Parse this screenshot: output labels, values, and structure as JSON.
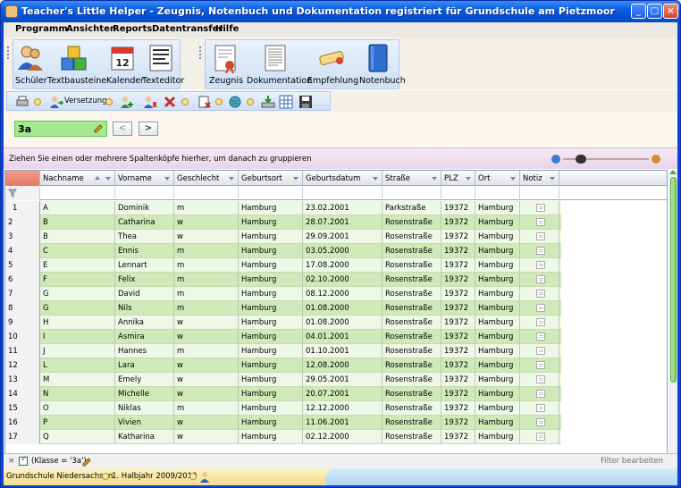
{
  "window": {
    "title": "Teacher's Little Helper - Zeugnis, Notenbuch und Dokumentation registriert für Grundschule am Pietzmoor"
  },
  "menu": [
    "Programm",
    "Ansichten",
    "Reports",
    "Datentransfer",
    "Hilfe"
  ],
  "ribbon": {
    "group1": [
      {
        "label": "Schüler",
        "icon": "students-icon"
      },
      {
        "label": "Textbausteine",
        "icon": "blocks-icon"
      },
      {
        "label": "Kalender",
        "icon": "calendar-icon"
      },
      {
        "label": "Texteditor",
        "icon": "text-editor-icon"
      }
    ],
    "group2": [
      {
        "label": "Zeugnis",
        "icon": "certificate-icon"
      },
      {
        "label": "Dokumentation",
        "icon": "documentation-icon"
      },
      {
        "label": "Empfehlung",
        "icon": "scroll-icon"
      },
      {
        "label": "Notenbuch",
        "icon": "gradebook-icon"
      }
    ],
    "calendar_day": "12"
  },
  "toolbar": {
    "versetzung_label": "Versetzung"
  },
  "class_selector": {
    "value": "3a",
    "prev": "<",
    "next": ">"
  },
  "groupbar": {
    "text": "Ziehen Sie einen oder mehrere Spaltenköpfe hierher, um danach zu gruppieren"
  },
  "table": {
    "columns": [
      "Nachname",
      "Vorname",
      "Geschlecht",
      "Geburtsort",
      "Geburtsdatum",
      "Straße",
      "PLZ",
      "Ort",
      "Notiz"
    ],
    "rows": [
      [
        "1",
        "A",
        "Dominik",
        "m",
        "Hamburg",
        "23.02.2001",
        "Parkstraße",
        "19372",
        "Hamburg"
      ],
      [
        "2",
        "B",
        "Catharina",
        "w",
        "Hamburg",
        "28.07.2001",
        "Rosenstraße",
        "19372",
        "Hamburg"
      ],
      [
        "3",
        "B",
        "Thea",
        "w",
        "Hamburg",
        "29.09.2001",
        "Rosenstraße",
        "19372",
        "Hamburg"
      ],
      [
        "4",
        "C",
        "Ennis",
        "m",
        "Hamburg",
        "03.05.2000",
        "Rosenstraße",
        "19372",
        "Hamburg"
      ],
      [
        "5",
        "E",
        "Lennart",
        "m",
        "Hamburg",
        "17.08.2000",
        "Rosenstraße",
        "19372",
        "Hamburg"
      ],
      [
        "6",
        "F",
        "Felix",
        "m",
        "Hamburg",
        "02.10.2000",
        "Rosenstraße",
        "19372",
        "Hamburg"
      ],
      [
        "7",
        "G",
        "David",
        "m",
        "Hamburg",
        "08.12.2000",
        "Rosenstraße",
        "19372",
        "Hamburg"
      ],
      [
        "8",
        "G",
        "Nils",
        "m",
        "Hamburg",
        "01.08.2000",
        "Rosenstraße",
        "19372",
        "Hamburg"
      ],
      [
        "9",
        "H",
        "Annika",
        "w",
        "Hamburg",
        "01.08.2000",
        "Rosenstraße",
        "19372",
        "Hamburg"
      ],
      [
        "10",
        "I",
        "Asmira",
        "w",
        "Hamburg",
        "04.01.2001",
        "Rosenstraße",
        "19372",
        "Hamburg"
      ],
      [
        "11",
        "J",
        "Hannes",
        "m",
        "Hamburg",
        "01.10.2001",
        "Rosenstraße",
        "19372",
        "Hamburg"
      ],
      [
        "12",
        "L",
        "Lara",
        "w",
        "Hamburg",
        "12.08.2000",
        "Rosenstraße",
        "19372",
        "Hamburg"
      ],
      [
        "13",
        "M",
        "Emely",
        "w",
        "Hamburg",
        "29.05.2001",
        "Rosenstraße",
        "19372",
        "Hamburg"
      ],
      [
        "14",
        "N",
        "Michelle",
        "w",
        "Hamburg",
        "20.07.2001",
        "Rosenstraße",
        "19372",
        "Hamburg"
      ],
      [
        "15",
        "O",
        "Niklas",
        "m",
        "Hamburg",
        "12.12.2000",
        "Rosenstraße",
        "19372",
        "Hamburg"
      ],
      [
        "16",
        "P",
        "Vivien",
        "w",
        "Hamburg",
        "11.06.2001",
        "Rosenstraße",
        "19372",
        "Hamburg"
      ],
      [
        "17",
        "Q",
        "Katharina",
        "w",
        "Hamburg",
        "02.12.2000",
        "Rosenstraße",
        "19372",
        "Hamburg"
      ]
    ]
  },
  "filter": {
    "close": "×",
    "expression": "(Klasse = '3a')",
    "edit_label": "Filter bearbeiten"
  },
  "status": {
    "state": "Grundschule Niedersachsen",
    "term": "1. Halbjahr 2009/2010"
  },
  "colors": {
    "row_even": "#eef8e6",
    "row_odd": "#cfeab8",
    "accent": "#0a46d6",
    "combo": "#a4e890"
  }
}
